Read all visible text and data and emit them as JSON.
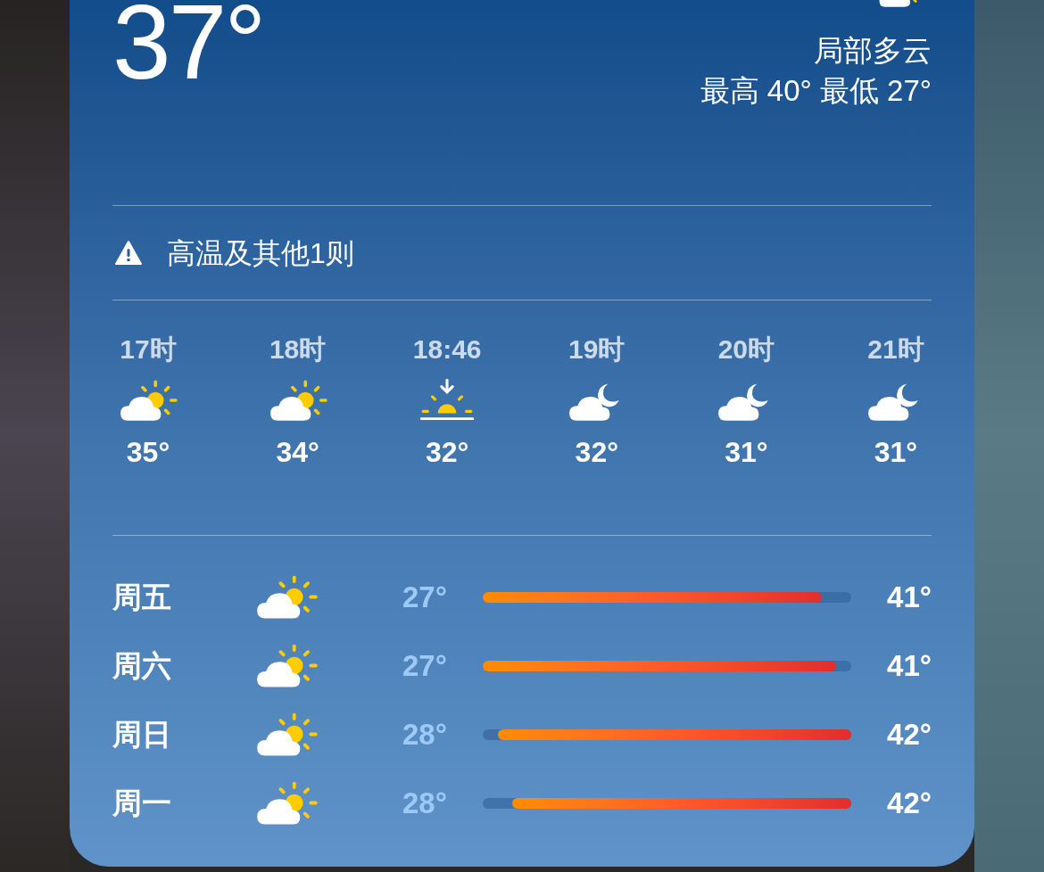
{
  "current": {
    "temperature": "37°",
    "kind": "cloud-sun",
    "condition": "局部多云",
    "high_low": "最高 40° 最低 27°"
  },
  "alert": {
    "text": "高温及其他1则"
  },
  "hourly": [
    {
      "time": "17时",
      "kind": "cloud-sun",
      "temp": "35°"
    },
    {
      "time": "18时",
      "kind": "cloud-sun",
      "temp": "34°"
    },
    {
      "time": "18:46",
      "kind": "sunset",
      "temp": "32°"
    },
    {
      "time": "19时",
      "kind": "cloud-moon",
      "temp": "32°"
    },
    {
      "time": "20时",
      "kind": "cloud-moon",
      "temp": "31°"
    },
    {
      "time": "21时",
      "kind": "cloud-moon",
      "temp": "31°"
    }
  ],
  "daily": [
    {
      "day": "周五",
      "kind": "start",
      "low": "27°",
      "high": "41°",
      "level": 0.92
    },
    {
      "day": "周六",
      "kind": "start",
      "low": "27°",
      "high": "41°",
      "level": 0.96
    },
    {
      "day": "周日",
      "kind": "end",
      "low": "28°",
      "high": "42°",
      "level": 0.96
    },
    {
      "day": "周一",
      "kind": "end",
      "low": "28°",
      "high": "42°",
      "level": 0.92
    }
  ]
}
